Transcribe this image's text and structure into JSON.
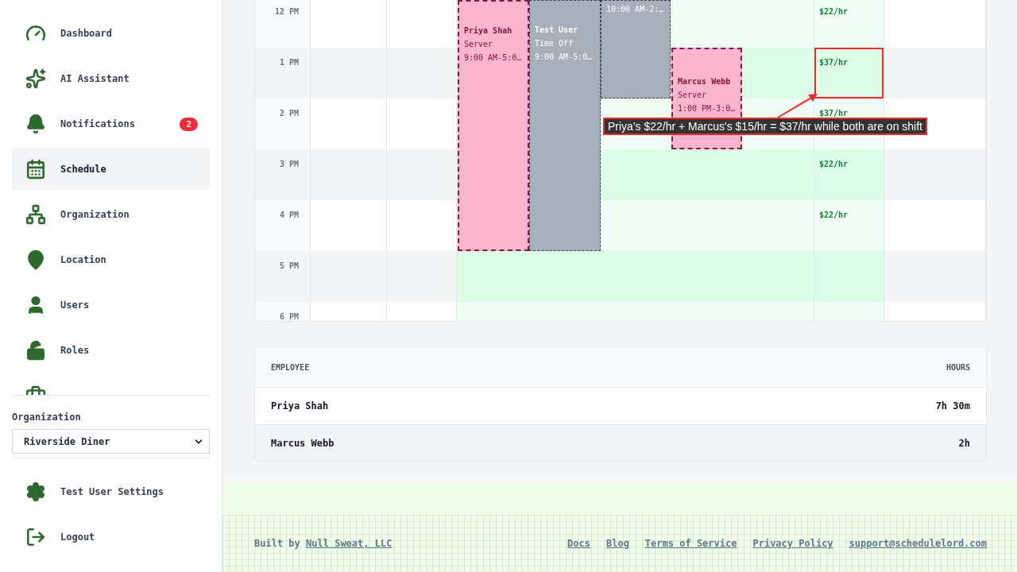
{
  "sidebar": {
    "nav_items": [
      {
        "label": "Dashboard",
        "selected": false
      },
      {
        "label": "AI Assistant",
        "selected": false
      },
      {
        "label": "Notifications",
        "selected": false,
        "badge": "2"
      },
      {
        "label": "Schedule",
        "selected": true
      },
      {
        "label": "Organization",
        "selected": false
      },
      {
        "label": "Location",
        "selected": false
      },
      {
        "label": "Users",
        "selected": false
      },
      {
        "label": "Roles",
        "selected": false
      }
    ],
    "organization": {
      "label": "Organization",
      "value": "Riverside Diner"
    },
    "bottom_items": [
      {
        "label": "Test User Settings"
      },
      {
        "label": "Logout"
      }
    ]
  },
  "calendar": {
    "hours": [
      "12 PM",
      "1 PM",
      "2 PM",
      "3 PM",
      "4 PM",
      "5 PM",
      "6 PM"
    ],
    "rates": [
      {
        "text": "$22/hr",
        "highlighted": false
      },
      {
        "text": "$37/hr",
        "highlighted": true
      },
      {
        "text": "$37/hr",
        "highlighted": false
      },
      {
        "text": "$22/hr",
        "highlighted": false
      },
      {
        "text": "$22/hr",
        "highlighted": false
      }
    ],
    "events": [
      {
        "kind": "shift",
        "name": "Priya Shah",
        "role": "Server",
        "time": "9:00 AM-5:0…"
      },
      {
        "kind": "time_off",
        "name": "Test User",
        "role": "Time Off",
        "time": "9:00 AM-5:0…"
      },
      {
        "kind": "time_off",
        "time": "10:00 AM-2:…"
      },
      {
        "kind": "shift",
        "name": "Marcus Webb",
        "role": "Server",
        "time": "1:00 PM-3:0…"
      }
    ],
    "callout": "Priya's $22/hr + Marcus's $15/hr = $37/hr while both are on shift"
  },
  "summary": {
    "columns": [
      "EMPLOYEE",
      "HOURS"
    ],
    "rows": [
      [
        "Priya Shah",
        "7h 30m"
      ],
      [
        "Marcus Webb",
        "2h"
      ]
    ]
  },
  "footer": {
    "built_by": "Built by",
    "company": "Null Sweat, LLC",
    "links": [
      "Docs",
      "Blog",
      "Terms of Service",
      "Privacy Policy",
      "support@schedulelord.com"
    ]
  }
}
